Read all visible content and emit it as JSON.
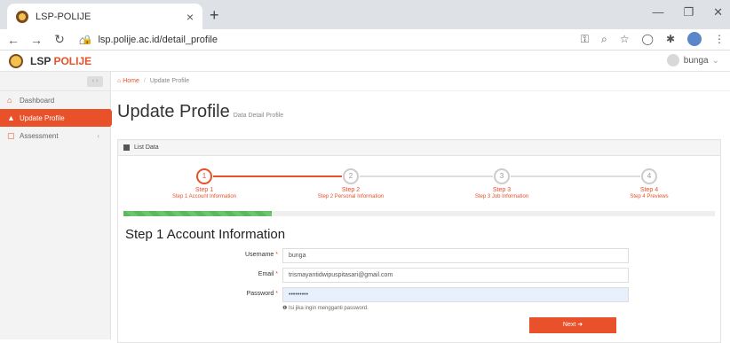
{
  "browser": {
    "tab_title": "LSP-POLIJE",
    "tab_close": "×",
    "new_tab": "+",
    "url": "lsp.polije.ac.id/detail_profile",
    "win_min": "—",
    "win_max": "❐",
    "win_close": "✕"
  },
  "app": {
    "logo_prefix": "LSP",
    "logo_suffix": "POLIJE",
    "user_name": "bunga"
  },
  "sidebar": {
    "toggle": "‹ ›",
    "items": [
      {
        "label": "Dashboard",
        "icon": "home-icon",
        "glyph": "⌂"
      },
      {
        "label": "Update Profile",
        "icon": "user-icon",
        "glyph": "▲"
      },
      {
        "label": "Assessment",
        "icon": "file-icon",
        "glyph": "▢",
        "chevron": "‹"
      }
    ]
  },
  "breadcrumb": {
    "home": "Home",
    "separator": "/",
    "current": "Update Profile"
  },
  "page": {
    "title": "Update Profile",
    "subtitle": "Data Detail Profile"
  },
  "panel": {
    "title": "List Data"
  },
  "steps": [
    {
      "num": "1",
      "label": "Step 1",
      "sub": "Step 1 Account Information",
      "active": true
    },
    {
      "num": "2",
      "label": "Step 2",
      "sub": "Step 2 Personal Information",
      "active": false
    },
    {
      "num": "3",
      "label": "Step 3",
      "sub": "Step 3 Job Information",
      "active": false
    },
    {
      "num": "4",
      "label": "Step 4",
      "sub": "Step 4 Previews",
      "active": false
    }
  ],
  "progress": {
    "fraction": 0.25
  },
  "form": {
    "title": "Step 1 Account Information",
    "username_label": "Username",
    "username_value": "bunga",
    "email_label": "Email",
    "email_value": "trismayantidwipuspitasari@gmail.com",
    "password_label": "Password",
    "password_value": "•••••••••",
    "required_mark": "*",
    "hint": "❶ Isi jika ingin mengganti password.",
    "next_label": "Next ➜"
  },
  "colors": {
    "accent": "#e8512a",
    "progress": "#5cb85c"
  }
}
